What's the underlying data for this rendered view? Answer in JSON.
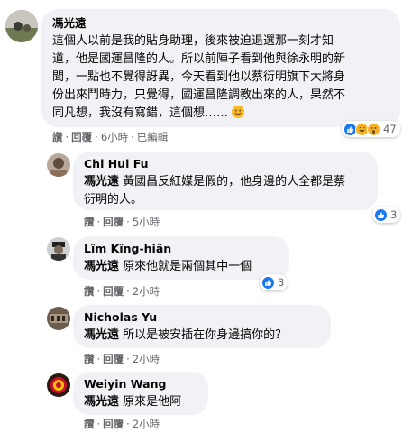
{
  "comments": [
    {
      "author": "馮光遠",
      "lines": [
        "這個人以前是我的貼身助理，後來被迫退選那一刻才知",
        "道，他是國運昌隆的人。所以前陣子看到他與徐永明的新",
        "聞，一點也不覺得訝異，今天看到他以蔡衍明旗下大將身",
        "份出來鬥時力，只覺得，國運昌隆調教出來的人，果然不",
        "同凡想，我沒有寫錯，這個想……"
      ],
      "emoji": "smiley-emoji",
      "actions": {
        "like": "讚",
        "reply": "回覆",
        "time": "6小時",
        "edited": "已編輯"
      },
      "reactions": {
        "icons": [
          "like-icon",
          "haha-icon",
          "wow-icon"
        ],
        "count": "47"
      }
    },
    {
      "author": "Chi Hui Fu",
      "tag": "馮光遠",
      "lines": [
        "黃國昌反紅媒是假的，他身邊的人全都是蔡",
        "衍明的人。"
      ],
      "actions": {
        "like": "讚",
        "reply": "回覆",
        "time": "5小時"
      },
      "reactions": {
        "icons": [
          "like-icon"
        ],
        "count": "3"
      }
    },
    {
      "author": "Lîm Kîng-hiân",
      "tag": "馮光遠",
      "lines": [
        "原來他就是兩個其中一個"
      ],
      "actions": {
        "like": "讚",
        "reply": "回覆",
        "time": "2小時"
      },
      "reactions": {
        "icons": [
          "like-icon"
        ],
        "count": "3"
      }
    },
    {
      "author": "Nicholas Yu",
      "tag": "馮光遠",
      "lines": [
        "所以是被安插在你身邊搞你的？"
      ],
      "actions": {
        "like": "讚",
        "reply": "回覆",
        "time": "2小時"
      }
    },
    {
      "author": "Weiyin Wang",
      "tag": "馮光遠",
      "lines": [
        "原來是他阿"
      ],
      "actions": {
        "like": "讚",
        "reply": "回覆",
        "time": "2小時"
      }
    }
  ],
  "colors": {
    "bubble": "#f0f2f5",
    "like": "#1877f2",
    "emoji": "#f7b125",
    "meta": "#65676b"
  }
}
